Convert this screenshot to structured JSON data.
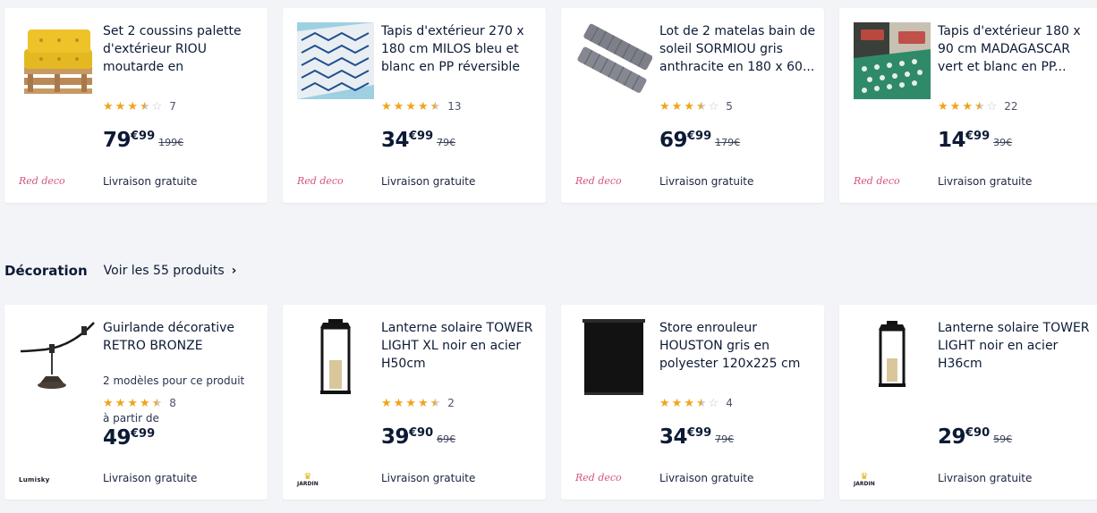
{
  "section": {
    "title": "Décoration",
    "link": "Voir les 55 produits"
  },
  "colors": {
    "star": "#f0a41b",
    "text": "#0c1a35",
    "reddeco": "#d3557b"
  },
  "row1": [
    {
      "title": "Set 2 coussins palette d'extérieur RIOU moutarde en",
      "rating": 3.5,
      "reviews": "7",
      "price_int": "79",
      "price_dec": "€99",
      "old_price": "199€",
      "seller": "Red deco",
      "delivery": "Livraison gratuite",
      "image": "yellow-pallet-cushion"
    },
    {
      "title": "Tapis d'extérieur 270 x 180 cm MILOS bleu et blanc en PP réversible",
      "rating": 4.5,
      "reviews": "13",
      "price_int": "34",
      "price_dec": "€99",
      "old_price": "79€",
      "seller": "Red deco",
      "delivery": "Livraison gratuite",
      "image": "blue-white-rug"
    },
    {
      "title": "Lot de 2 matelas bain de soleil SORMIOU gris anthracite en 180 x 60...",
      "rating": 3.5,
      "reviews": "5",
      "price_int": "69",
      "price_dec": "€99",
      "old_price": "179€",
      "seller": "Red deco",
      "delivery": "Livraison gratuite",
      "image": "grey-sun-mattresses"
    },
    {
      "title": "Tapis d'extérieur 180 x 90 cm MADAGASCAR vert et blanc en PP...",
      "rating": 3.5,
      "reviews": "22",
      "price_int": "14",
      "price_dec": "€99",
      "old_price": "39€",
      "seller": "Red deco",
      "delivery": "Livraison gratuite",
      "image": "green-white-rug"
    }
  ],
  "row2": [
    {
      "title": "Guirlande décorative RETRO BRONZE",
      "variants": "2 modèles pour ce produit",
      "rating": 4.5,
      "reviews": "8",
      "from_label": "à partir de",
      "price_int": "49",
      "price_dec": "€99",
      "old_price": "",
      "seller": "Lumisky",
      "delivery": "Livraison gratuite",
      "image": "retro-string-lights"
    },
    {
      "title": "Lanterne solaire TOWER LIGHT XL noir en acier H50cm",
      "rating": 4.5,
      "reviews": "2",
      "price_int": "39",
      "price_dec": "€90",
      "old_price": "69€",
      "seller": "JARDIN",
      "delivery": "Livraison gratuite",
      "image": "black-lantern"
    },
    {
      "title": "Store enrouleur HOUSTON gris en polyester 120x225 cm",
      "rating": 3.5,
      "reviews": "4",
      "price_int": "34",
      "price_dec": "€99",
      "old_price": "79€",
      "seller": "Red deco",
      "delivery": "Livraison gratuite",
      "image": "roller-blind"
    },
    {
      "title": "Lanterne solaire TOWER LIGHT noir en acier H36cm",
      "rating": 0,
      "reviews": "",
      "price_int": "29",
      "price_dec": "€90",
      "old_price": "59€",
      "seller": "JARDIN",
      "delivery": "Livraison gratuite",
      "image": "black-lantern"
    }
  ]
}
